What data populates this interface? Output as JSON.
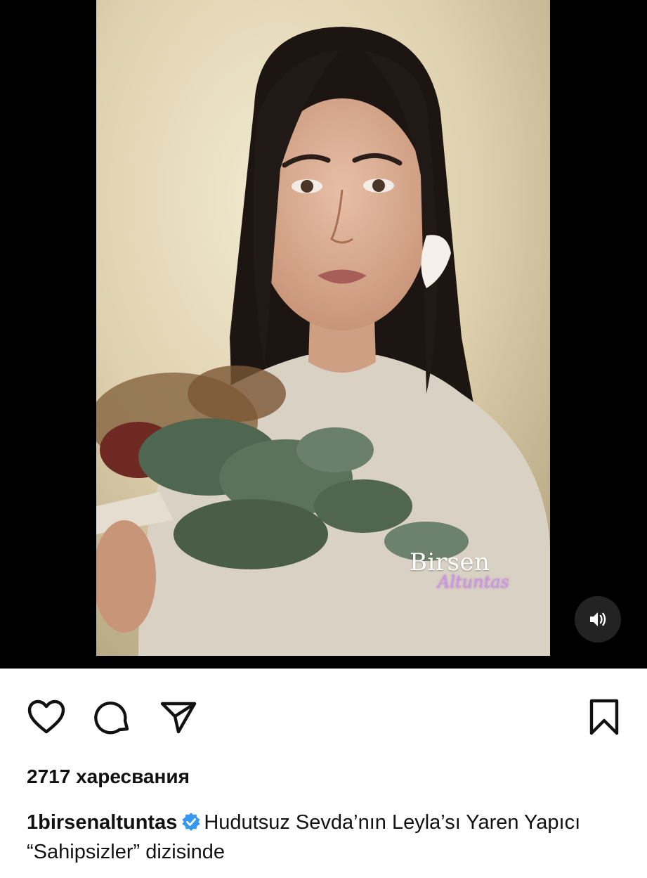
{
  "post": {
    "watermark": {
      "line1": "Birsen",
      "line2": "Altuntas"
    },
    "likes_text": "2717 харесвания",
    "username": "1birsenaltuntas",
    "caption_text": "Hudutsuz Sevda’nın Leyla’sı Yaren Yapıcı “Sahipsizler” dizisinde"
  },
  "icons": {
    "sound": "speaker-volume-icon",
    "like": "heart-icon",
    "comment": "comment-bubble-icon",
    "share": "paper-plane-icon",
    "save": "bookmark-icon",
    "verified": "verified-badge-icon"
  },
  "colors": {
    "media_background": "#000000",
    "page_background": "#ffffff",
    "text": "#111111",
    "verified_blue": "#3897f0",
    "watermark_accent": "#c89ad9"
  }
}
